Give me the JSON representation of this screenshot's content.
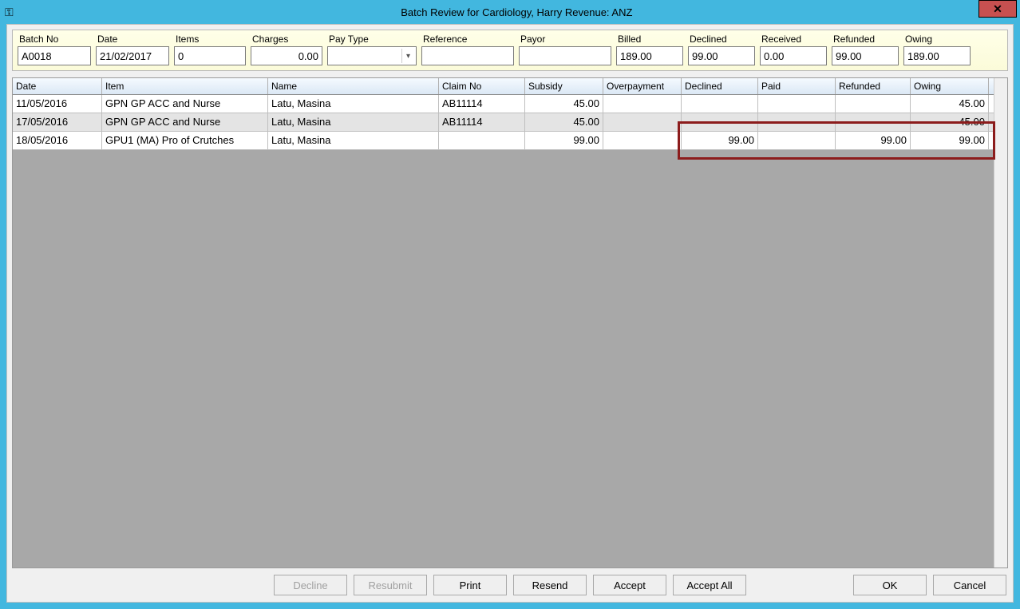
{
  "window": {
    "title": "Batch Review for Cardiology, Harry Revenue: ANZ"
  },
  "summary": {
    "batch_no": {
      "label": "Batch No",
      "value": "A0018"
    },
    "date": {
      "label": "Date",
      "value": "21/02/2017"
    },
    "items": {
      "label": "Items",
      "value": "0"
    },
    "charges": {
      "label": "Charges",
      "value": "0.00"
    },
    "pay_type": {
      "label": "Pay Type",
      "value": ""
    },
    "reference": {
      "label": "Reference",
      "value": ""
    },
    "payor": {
      "label": "Payor",
      "value": ""
    },
    "billed": {
      "label": "Billed",
      "value": "189.00"
    },
    "declined": {
      "label": "Declined",
      "value": "99.00"
    },
    "received": {
      "label": "Received",
      "value": "0.00"
    },
    "refunded": {
      "label": "Refunded",
      "value": "99.00"
    },
    "owing": {
      "label": "Owing",
      "value": "189.00"
    }
  },
  "grid": {
    "headers": [
      "Date",
      "Item",
      "Name",
      "Claim No",
      "Subsidy",
      "Overpayment",
      "Declined",
      "Paid",
      "Refunded",
      "Owing"
    ],
    "rows": [
      {
        "date": "11/05/2016",
        "item": "GPN GP ACC and Nurse",
        "name": "Latu, Masina",
        "claim_no": "AB11114",
        "subsidy": "45.00",
        "overpayment": "",
        "declined": "",
        "paid": "",
        "refunded": "",
        "owing": "45.00"
      },
      {
        "date": "17/05/2016",
        "item": "GPN GP ACC and Nurse",
        "name": "Latu, Masina",
        "claim_no": "AB11114",
        "subsidy": "45.00",
        "overpayment": "",
        "declined": "",
        "paid": "",
        "refunded": "",
        "owing": "45.00"
      },
      {
        "date": "18/05/2016",
        "item": "GPU1 (MA) Pro of Crutches",
        "name": "Latu, Masina",
        "claim_no": "",
        "subsidy": "99.00",
        "overpayment": "",
        "declined": "99.00",
        "paid": "",
        "refunded": "99.00",
        "owing": "99.00"
      }
    ]
  },
  "buttons": {
    "decline": "Decline",
    "resubmit": "Resubmit",
    "print": "Print",
    "resend": "Resend",
    "accept": "Accept",
    "accept_all": "Accept All",
    "ok": "OK",
    "cancel": "Cancel"
  }
}
